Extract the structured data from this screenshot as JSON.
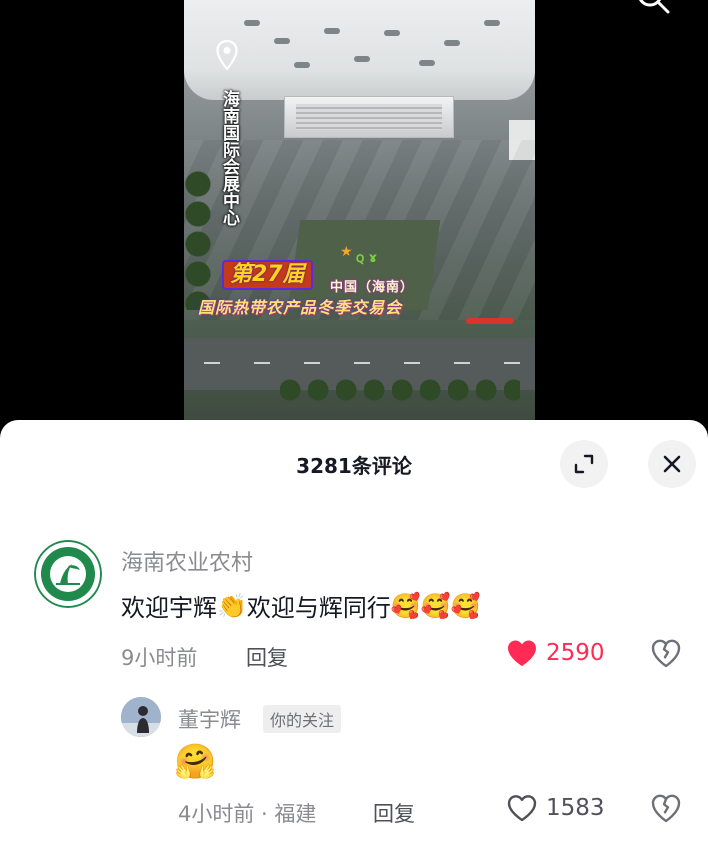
{
  "video": {
    "location_title": "海南国际会展中心",
    "banner": {
      "edition": "第27届",
      "line1": "中国（海南）",
      "line2": "国际热带农产品冬季交易会"
    }
  },
  "comments_panel": {
    "title": "3281条评论",
    "comments": [
      {
        "author": "海南农业农村",
        "text_parts": [
          "欢迎宇辉",
          "👏",
          "欢迎与辉同行",
          "🥰🥰🥰"
        ],
        "time": "9小时前",
        "reply_label": "回复",
        "likes": "2590",
        "liked": true,
        "replies": [
          {
            "author": "董宇辉",
            "tag": "你的关注",
            "text": "🤗",
            "time": "4小时前 · 福建",
            "reply_label": "回复",
            "likes": "1583",
            "liked": false
          }
        ]
      }
    ]
  },
  "colors": {
    "like_red": "#fe2c55",
    "text_primary": "#161823",
    "text_secondary": "#8a8b91",
    "avatar_green": "#1f8a4c"
  },
  "icons": [
    "location-pin-icon",
    "search-icon",
    "expand-icon",
    "close-icon",
    "heart-filled-icon",
    "heart-outline-icon",
    "broken-heart-icon"
  ]
}
